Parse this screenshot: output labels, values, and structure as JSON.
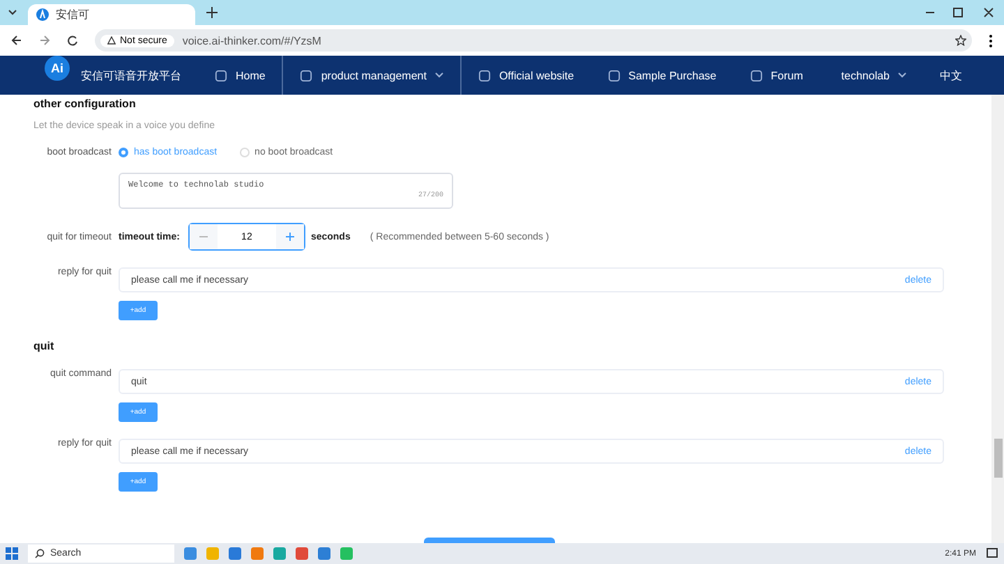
{
  "browser": {
    "tab_title": "安信可",
    "security_label": "Not secure",
    "address": "voice.ai-thinker.com/#/YzsM"
  },
  "nav": {
    "logo_mark": "Ai",
    "logo_text": "安信可语音开放平台",
    "items": [
      {
        "label": "Home",
        "kind": "link",
        "selected": false
      },
      {
        "label": "product management",
        "kind": "dropdown",
        "selected": true
      },
      {
        "label": "Official website",
        "kind": "link",
        "selected": false
      },
      {
        "label": "Sample Purchase",
        "kind": "link",
        "selected": false
      },
      {
        "label": "Forum",
        "kind": "link",
        "selected": false
      }
    ],
    "user": "technolab",
    "language": "中文"
  },
  "other_configuration": {
    "title": "other configuration",
    "subtitle": "Let the device speak in a voice you define",
    "boot_broadcast": {
      "label": "boot broadcast",
      "options": [
        {
          "label": "has boot broadcast",
          "selected": true
        },
        {
          "label": "no boot broadcast",
          "selected": false
        }
      ],
      "message": "Welcome to technolab studio",
      "counter": "27/200"
    },
    "timeout": {
      "label": "quit for timeout",
      "field_label": "timeout time:",
      "value": "12",
      "unit": "seconds",
      "hint": "( Recommended between 5-60 seconds )"
    },
    "groups": [
      {
        "label": "reply for quit",
        "entries": [
          {
            "text": "please call me if necessary",
            "action": "delete"
          }
        ],
        "add": "+add"
      }
    ]
  },
  "quit": {
    "title": "quit",
    "groups": [
      {
        "label": "quit command",
        "entries": [
          {
            "text": "quit",
            "action": "delete"
          }
        ],
        "add": "+add"
      },
      {
        "label": "reply for quit",
        "entries": [
          {
            "text": "please call me if necessary",
            "action": "delete"
          }
        ],
        "add": "+add"
      }
    ]
  },
  "taskbar": {
    "search": "Search",
    "time": "2:41 PM"
  }
}
